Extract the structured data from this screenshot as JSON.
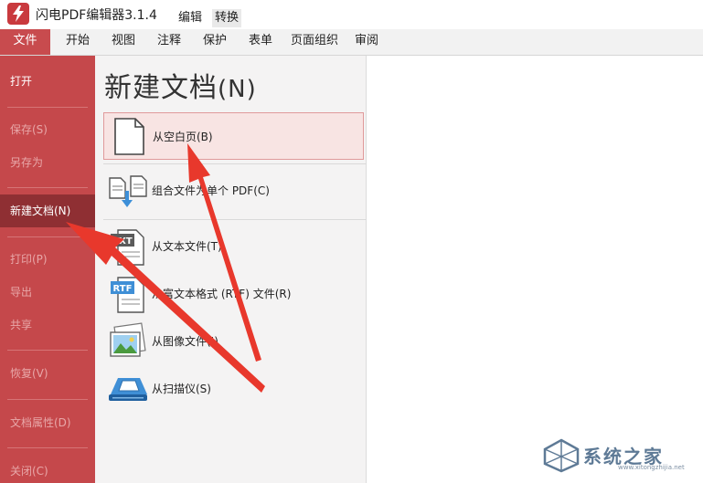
{
  "app": {
    "title": "闪电PDF编辑器3.1.4"
  },
  "mode_tabs": {
    "edit": "编辑",
    "convert": "转换"
  },
  "menu": {
    "items": [
      "文件",
      "开始",
      "视图",
      "注释",
      "保护",
      "表单",
      "页面组织",
      "审阅"
    ],
    "active": "文件"
  },
  "sidebar": {
    "items": [
      {
        "label": "打开",
        "enabled": true
      },
      {
        "label": "保存(S)",
        "enabled": false
      },
      {
        "label": "另存为",
        "enabled": false
      },
      {
        "label": "新建文档(N)",
        "enabled": true,
        "active": true
      },
      {
        "label": "打印(P)",
        "enabled": false
      },
      {
        "label": "导出",
        "enabled": false
      },
      {
        "label": "共享",
        "enabled": false
      },
      {
        "label": "恢复(V)",
        "enabled": false
      },
      {
        "label": "文档属性(D)",
        "enabled": false
      },
      {
        "label": "关闭(C)",
        "enabled": false
      }
    ]
  },
  "panel": {
    "heading": "新建文档",
    "heading_hotkey": "(N)",
    "options": [
      {
        "label": "从空白页(B)",
        "icon": "blank-page-icon",
        "selected": true
      },
      {
        "label": "组合文件为单个 PDF(C)",
        "icon": "combine-files-icon"
      },
      {
        "label": "从文本文件(T)",
        "icon": "txt-file-icon",
        "icon_text": "TXT"
      },
      {
        "label": "从富文本格式 (RTF) 文件(R)",
        "icon": "rtf-file-icon",
        "icon_text": "RTF"
      },
      {
        "label": "从图像文件(I)",
        "icon": "image-file-icon"
      },
      {
        "label": "从扫描仪(S)",
        "icon": "scanner-icon"
      }
    ]
  },
  "watermark": {
    "text": "系统之家",
    "url": "www.xitongzhijia.net"
  },
  "colors": {
    "sidebar": "#c5484b",
    "sidebar_active": "#8f2f33",
    "arrow": "#e8382c",
    "selected_option_bg": "#f8e4e3"
  }
}
